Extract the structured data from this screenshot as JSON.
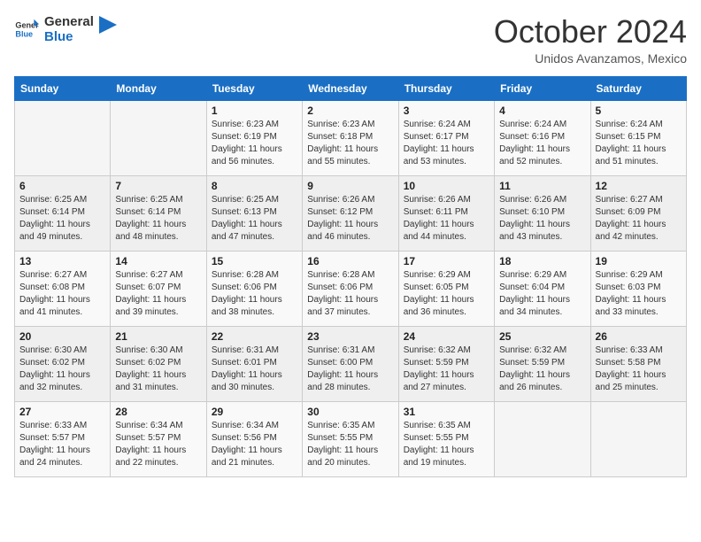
{
  "header": {
    "logo_line1": "General",
    "logo_line2": "Blue",
    "month": "October 2024",
    "location": "Unidos Avanzamos, Mexico"
  },
  "weekdays": [
    "Sunday",
    "Monday",
    "Tuesday",
    "Wednesday",
    "Thursday",
    "Friday",
    "Saturday"
  ],
  "weeks": [
    [
      {
        "day": "",
        "sunrise": "",
        "sunset": "",
        "daylight": ""
      },
      {
        "day": "",
        "sunrise": "",
        "sunset": "",
        "daylight": ""
      },
      {
        "day": "1",
        "sunrise": "Sunrise: 6:23 AM",
        "sunset": "Sunset: 6:19 PM",
        "daylight": "Daylight: 11 hours and 56 minutes."
      },
      {
        "day": "2",
        "sunrise": "Sunrise: 6:23 AM",
        "sunset": "Sunset: 6:18 PM",
        "daylight": "Daylight: 11 hours and 55 minutes."
      },
      {
        "day": "3",
        "sunrise": "Sunrise: 6:24 AM",
        "sunset": "Sunset: 6:17 PM",
        "daylight": "Daylight: 11 hours and 53 minutes."
      },
      {
        "day": "4",
        "sunrise": "Sunrise: 6:24 AM",
        "sunset": "Sunset: 6:16 PM",
        "daylight": "Daylight: 11 hours and 52 minutes."
      },
      {
        "day": "5",
        "sunrise": "Sunrise: 6:24 AM",
        "sunset": "Sunset: 6:15 PM",
        "daylight": "Daylight: 11 hours and 51 minutes."
      }
    ],
    [
      {
        "day": "6",
        "sunrise": "Sunrise: 6:25 AM",
        "sunset": "Sunset: 6:14 PM",
        "daylight": "Daylight: 11 hours and 49 minutes."
      },
      {
        "day": "7",
        "sunrise": "Sunrise: 6:25 AM",
        "sunset": "Sunset: 6:14 PM",
        "daylight": "Daylight: 11 hours and 48 minutes."
      },
      {
        "day": "8",
        "sunrise": "Sunrise: 6:25 AM",
        "sunset": "Sunset: 6:13 PM",
        "daylight": "Daylight: 11 hours and 47 minutes."
      },
      {
        "day": "9",
        "sunrise": "Sunrise: 6:26 AM",
        "sunset": "Sunset: 6:12 PM",
        "daylight": "Daylight: 11 hours and 46 minutes."
      },
      {
        "day": "10",
        "sunrise": "Sunrise: 6:26 AM",
        "sunset": "Sunset: 6:11 PM",
        "daylight": "Daylight: 11 hours and 44 minutes."
      },
      {
        "day": "11",
        "sunrise": "Sunrise: 6:26 AM",
        "sunset": "Sunset: 6:10 PM",
        "daylight": "Daylight: 11 hours and 43 minutes."
      },
      {
        "day": "12",
        "sunrise": "Sunrise: 6:27 AM",
        "sunset": "Sunset: 6:09 PM",
        "daylight": "Daylight: 11 hours and 42 minutes."
      }
    ],
    [
      {
        "day": "13",
        "sunrise": "Sunrise: 6:27 AM",
        "sunset": "Sunset: 6:08 PM",
        "daylight": "Daylight: 11 hours and 41 minutes."
      },
      {
        "day": "14",
        "sunrise": "Sunrise: 6:27 AM",
        "sunset": "Sunset: 6:07 PM",
        "daylight": "Daylight: 11 hours and 39 minutes."
      },
      {
        "day": "15",
        "sunrise": "Sunrise: 6:28 AM",
        "sunset": "Sunset: 6:06 PM",
        "daylight": "Daylight: 11 hours and 38 minutes."
      },
      {
        "day": "16",
        "sunrise": "Sunrise: 6:28 AM",
        "sunset": "Sunset: 6:06 PM",
        "daylight": "Daylight: 11 hours and 37 minutes."
      },
      {
        "day": "17",
        "sunrise": "Sunrise: 6:29 AM",
        "sunset": "Sunset: 6:05 PM",
        "daylight": "Daylight: 11 hours and 36 minutes."
      },
      {
        "day": "18",
        "sunrise": "Sunrise: 6:29 AM",
        "sunset": "Sunset: 6:04 PM",
        "daylight": "Daylight: 11 hours and 34 minutes."
      },
      {
        "day": "19",
        "sunrise": "Sunrise: 6:29 AM",
        "sunset": "Sunset: 6:03 PM",
        "daylight": "Daylight: 11 hours and 33 minutes."
      }
    ],
    [
      {
        "day": "20",
        "sunrise": "Sunrise: 6:30 AM",
        "sunset": "Sunset: 6:02 PM",
        "daylight": "Daylight: 11 hours and 32 minutes."
      },
      {
        "day": "21",
        "sunrise": "Sunrise: 6:30 AM",
        "sunset": "Sunset: 6:02 PM",
        "daylight": "Daylight: 11 hours and 31 minutes."
      },
      {
        "day": "22",
        "sunrise": "Sunrise: 6:31 AM",
        "sunset": "Sunset: 6:01 PM",
        "daylight": "Daylight: 11 hours and 30 minutes."
      },
      {
        "day": "23",
        "sunrise": "Sunrise: 6:31 AM",
        "sunset": "Sunset: 6:00 PM",
        "daylight": "Daylight: 11 hours and 28 minutes."
      },
      {
        "day": "24",
        "sunrise": "Sunrise: 6:32 AM",
        "sunset": "Sunset: 5:59 PM",
        "daylight": "Daylight: 11 hours and 27 minutes."
      },
      {
        "day": "25",
        "sunrise": "Sunrise: 6:32 AM",
        "sunset": "Sunset: 5:59 PM",
        "daylight": "Daylight: 11 hours and 26 minutes."
      },
      {
        "day": "26",
        "sunrise": "Sunrise: 6:33 AM",
        "sunset": "Sunset: 5:58 PM",
        "daylight": "Daylight: 11 hours and 25 minutes."
      }
    ],
    [
      {
        "day": "27",
        "sunrise": "Sunrise: 6:33 AM",
        "sunset": "Sunset: 5:57 PM",
        "daylight": "Daylight: 11 hours and 24 minutes."
      },
      {
        "day": "28",
        "sunrise": "Sunrise: 6:34 AM",
        "sunset": "Sunset: 5:57 PM",
        "daylight": "Daylight: 11 hours and 22 minutes."
      },
      {
        "day": "29",
        "sunrise": "Sunrise: 6:34 AM",
        "sunset": "Sunset: 5:56 PM",
        "daylight": "Daylight: 11 hours and 21 minutes."
      },
      {
        "day": "30",
        "sunrise": "Sunrise: 6:35 AM",
        "sunset": "Sunset: 5:55 PM",
        "daylight": "Daylight: 11 hours and 20 minutes."
      },
      {
        "day": "31",
        "sunrise": "Sunrise: 6:35 AM",
        "sunset": "Sunset: 5:55 PM",
        "daylight": "Daylight: 11 hours and 19 minutes."
      },
      {
        "day": "",
        "sunrise": "",
        "sunset": "",
        "daylight": ""
      },
      {
        "day": "",
        "sunrise": "",
        "sunset": "",
        "daylight": ""
      }
    ]
  ]
}
